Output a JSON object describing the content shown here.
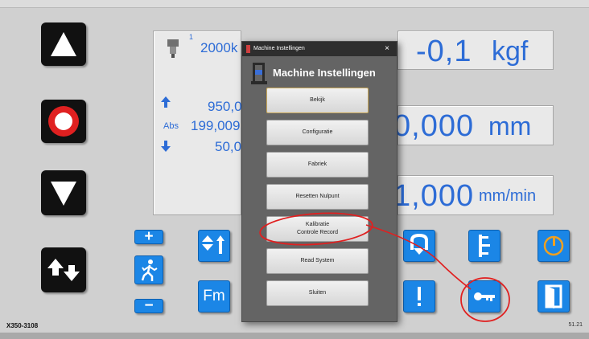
{
  "status": {
    "machine_id": "X350-3108",
    "version": "51.21"
  },
  "left_panel": {
    "capacity": "2000k",
    "sensor_index": "1",
    "upper_limit": "950,0",
    "abs_label": "Abs",
    "abs_value": "199,009",
    "lower_limit": "50,0"
  },
  "readouts": {
    "force": {
      "value": "-0,1",
      "unit": "kgf"
    },
    "position": {
      "value": "0,000",
      "unit": "mm"
    },
    "speed": {
      "value": "1,000",
      "unit": "mm/min"
    }
  },
  "side_buttons": {
    "plus_label": "+",
    "minus_label": "−",
    "fm_label": "Fm"
  },
  "dialog": {
    "window_title": "Machine Instellingen",
    "heading": "Machine Instellingen",
    "close_label": "×",
    "buttons": [
      {
        "label": "Bekijk"
      },
      {
        "label": "Configuratie"
      },
      {
        "label": "Fabriek"
      },
      {
        "label": "Resetten Nulpunt"
      },
      {
        "label": "Kalibratie\nControle Record"
      },
      {
        "label": "Read System"
      },
      {
        "label": "Sluiten"
      }
    ]
  },
  "colors": {
    "accent_blue": "#1b86e6",
    "readout_text": "#2d6cd6",
    "stop_red": "#e02020",
    "annotation_red": "#e02020",
    "power_orange": "#f0a020"
  },
  "icons": [
    "up-arrow-icon",
    "stop-icon",
    "down-arrow-icon",
    "jog-icon",
    "walk-icon",
    "sort-icon",
    "return-icon",
    "scale-icon",
    "exclamation-icon",
    "key-icon",
    "power-icon",
    "exit-door-icon",
    "load-cell-icon"
  ]
}
